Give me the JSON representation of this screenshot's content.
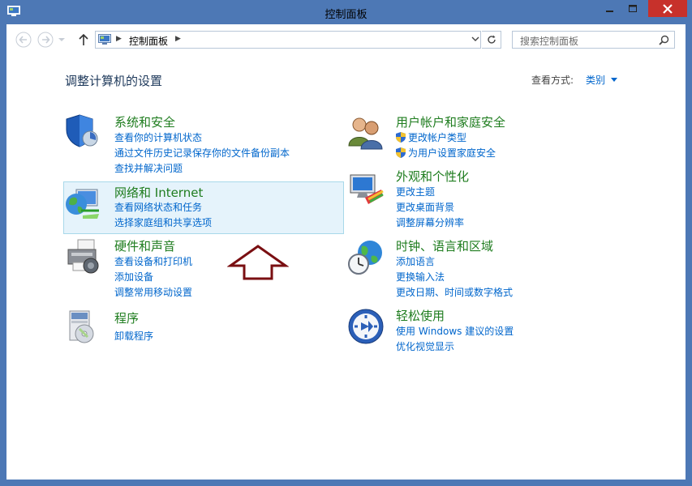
{
  "window": {
    "title": "控制面板"
  },
  "address": {
    "crumb": "控制面板"
  },
  "search": {
    "placeholder": "搜索控制面板"
  },
  "page": {
    "heading": "调整计算机的设置",
    "view_by_label": "查看方式:",
    "view_by_value": "类别"
  },
  "categories": [
    {
      "title": "系统和安全",
      "links": [
        "查看你的计算机状态",
        "通过文件历史记录保存你的文件备份副本",
        "查找并解决问题"
      ]
    },
    {
      "title": "网络和 Internet",
      "links": [
        "查看网络状态和任务",
        "选择家庭组和共享选项"
      ]
    },
    {
      "title": "硬件和声音",
      "links": [
        "查看设备和打印机",
        "添加设备",
        "调整常用移动设置"
      ]
    },
    {
      "title": "程序",
      "links": [
        "卸载程序"
      ]
    },
    {
      "title": "用户帐户和家庭安全",
      "links": [
        "更改帐户类型",
        "为用户设置家庭安全"
      ]
    },
    {
      "title": "外观和个性化",
      "links": [
        "更改主题",
        "更改桌面背景",
        "调整屏幕分辨率"
      ]
    },
    {
      "title": "时钟、语言和区域",
      "links": [
        "添加语言",
        "更换输入法",
        "更改日期、时间或数字格式"
      ]
    },
    {
      "title": "轻松使用",
      "links": [
        "使用 Windows 建议的设置",
        "优化视觉显示"
      ]
    }
  ],
  "icons": {
    "system": "shield-icon",
    "network": "globe-network-icon",
    "hardware": "printer-icon",
    "programs": "programs-icon",
    "users": "users-icon",
    "appearance": "monitor-palette-icon",
    "clock": "clock-globe-icon",
    "ease": "ease-of-access-icon"
  },
  "colors": {
    "title_green": "#1e7c1e",
    "link_blue": "#0066cc",
    "close_red": "#c7312b",
    "frame_blue": "#4d78b5",
    "arrow_red": "#7a0f12"
  }
}
